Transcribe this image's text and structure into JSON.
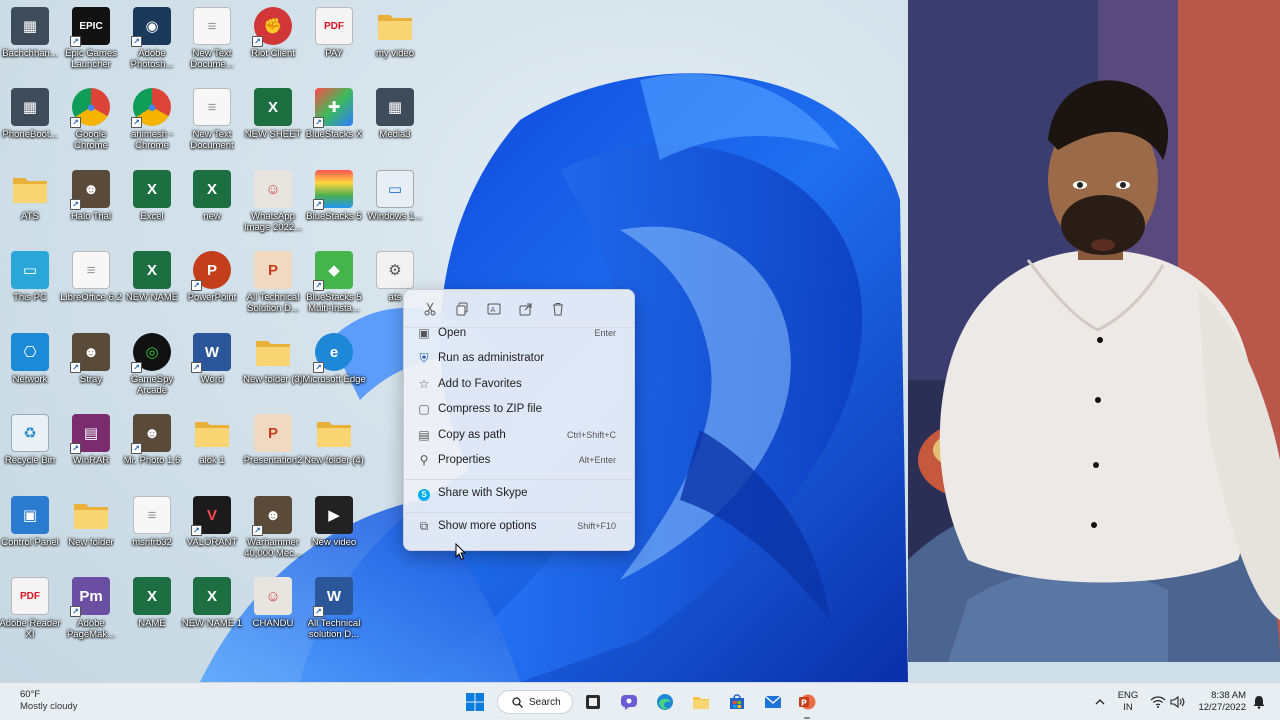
{
  "desktop": {
    "icons": [
      {
        "label": "Bachchhan..."
      },
      {
        "label": "Epic Games Launcher"
      },
      {
        "label": "Adobe Photosh..."
      },
      {
        "label": "New Text Docume..."
      },
      {
        "label": "Riot Client"
      },
      {
        "label": "PAY"
      },
      {
        "label": "my video"
      },
      {
        "label": "PhoneBoot..."
      },
      {
        "label": "Google Chrome"
      },
      {
        "label": "animesh - Chrome"
      },
      {
        "label": "New Text Document"
      },
      {
        "label": "NEW SHEET"
      },
      {
        "label": "BlueStacks X"
      },
      {
        "label": "Media3"
      },
      {
        "label": "ATS"
      },
      {
        "label": "Halo Trial"
      },
      {
        "label": "Excel"
      },
      {
        "label": "new"
      },
      {
        "label": "WhatsApp Image 2022..."
      },
      {
        "label": "BlueStacks 5"
      },
      {
        "label": "Windows 1..."
      },
      {
        "label": "This PC"
      },
      {
        "label": "LibreOffice 6.2"
      },
      {
        "label": "NEW NAME"
      },
      {
        "label": "PowerPoint"
      },
      {
        "label": "All Technical Solution D..."
      },
      {
        "label": "BlueStacks 5 Multi-Insta..."
      },
      {
        "label": "ats"
      },
      {
        "label": "Network"
      },
      {
        "label": "Stray"
      },
      {
        "label": "GameSpy Arcade"
      },
      {
        "label": "Word"
      },
      {
        "label": "New folder (3)"
      },
      {
        "label": "Microsoft Edge"
      },
      {
        "label": "Recycle Bin"
      },
      {
        "label": "WinRAR"
      },
      {
        "label": "Mr. Photo 1.6"
      },
      {
        "label": "alok 1"
      },
      {
        "label": "Presentation2"
      },
      {
        "label": "New folder (4)"
      },
      {
        "label": "Control Panel"
      },
      {
        "label": "New folder"
      },
      {
        "label": "msnfrb32"
      },
      {
        "label": "VALORANT"
      },
      {
        "label": "Warhammer 40,000 Mec..."
      },
      {
        "label": "New video"
      },
      {
        "label": "Adobe Reader XI"
      },
      {
        "label": "Adobe PageMak..."
      },
      {
        "label": "NAME"
      },
      {
        "label": "NEW NAME 1"
      },
      {
        "label": "CHANDU"
      },
      {
        "label": "All Technical solution D..."
      }
    ]
  },
  "context_menu": {
    "toolbar": [
      "cut-icon",
      "copy-icon",
      "rename-icon",
      "share-icon",
      "delete-icon"
    ],
    "items": [
      {
        "label": "Open",
        "shortcut": "Enter",
        "icon": "open-icon"
      },
      {
        "label": "Run as administrator",
        "shortcut": "",
        "icon": "shield-icon"
      },
      {
        "label": "Add to Favorites",
        "shortcut": "",
        "icon": "star-icon"
      },
      {
        "label": "Compress to ZIP file",
        "shortcut": "",
        "icon": "zip-icon"
      },
      {
        "label": "Copy as path",
        "shortcut": "Ctrl+Shift+C",
        "icon": "path-icon"
      },
      {
        "label": "Properties",
        "shortcut": "Alt+Enter",
        "icon": "wrench-icon"
      },
      {
        "label": "Share with Skype",
        "shortcut": "",
        "icon": "skype-icon"
      },
      {
        "label": "Show more options",
        "shortcut": "Shift+F10",
        "icon": "more-options-icon"
      }
    ]
  },
  "taskbar": {
    "weather_temp": "60°F",
    "weather_desc": "Mostly cloudy",
    "search_label": "Search",
    "apps": [
      "task-view-icon",
      "teams-chat-icon",
      "edge-icon",
      "file-explorer-icon",
      "store-icon",
      "mail-icon",
      "powerpoint-icon"
    ],
    "language_line1": "ENG",
    "language_line2": "IN",
    "time": "8:38 AM",
    "date": "12/27/2022"
  },
  "colors": {
    "accent": "#0067c0",
    "excel": "#1d6f42",
    "word": "#2b579a",
    "powerpoint": "#c43e1c",
    "folder": "#f6c343"
  }
}
